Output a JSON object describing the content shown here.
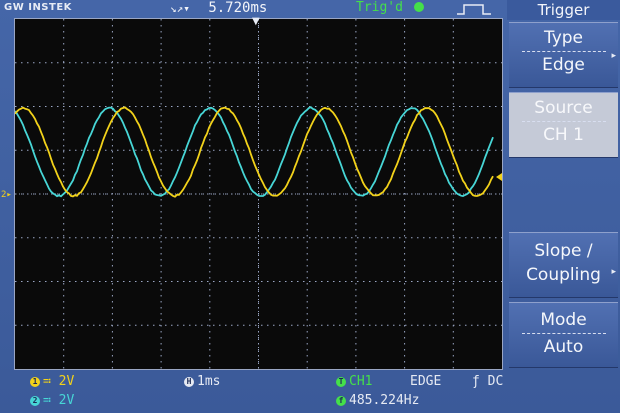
{
  "brand": "GW INSTEK",
  "top": {
    "time_arrows": "↘↗▾",
    "time_position": "5.720ms",
    "trigger_state": "Trig'd"
  },
  "menu": {
    "title": "Trigger",
    "items": [
      {
        "line1": "Type",
        "line2": "Edge",
        "enabled": true
      },
      {
        "line1": "Source",
        "line2": "CH 1",
        "enabled": false
      },
      {
        "line1": "Slope /",
        "line2": "Coupling",
        "enabled": true
      },
      {
        "line1": "Mode",
        "line2": "Auto",
        "enabled": true
      }
    ]
  },
  "bottom": {
    "ch1_badge": "1",
    "ch1_scale": "≕ 2V",
    "ch2_badge": "2",
    "ch2_scale": "≕ 2V",
    "timebase_badge": "H",
    "timebase": "1ms",
    "trigger_badge": "T",
    "trigger_source": "CH1",
    "trigger_type": "EDGE",
    "trigger_slope": "ƒ DC",
    "freq_badge": "f",
    "frequency": "485.224Hz"
  },
  "colors": {
    "ch1": "#f2d21a",
    "ch2": "#47d6d6",
    "trigger": "#45e04a",
    "grid": "#9aa6c4"
  },
  "markers": {
    "ch_ground_marker": "2▸",
    "trigger_top_marker": "▼"
  }
}
